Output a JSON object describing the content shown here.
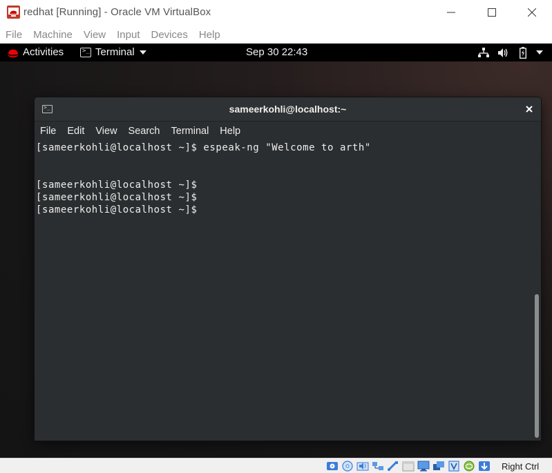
{
  "vbox": {
    "title": "redhat [Running] - Oracle VM VirtualBox",
    "menu": [
      "File",
      "Machine",
      "View",
      "Input",
      "Devices",
      "Help"
    ],
    "window_controls": {
      "minimize": "minimize-icon",
      "maximize": "maximize-icon",
      "close": "close-icon"
    },
    "status_icons": [
      "hard-disk-icon",
      "optical-disk-icon",
      "audio-icon",
      "network-icon",
      "usb-icon",
      "shared-folder-icon",
      "display-icon",
      "recording-icon",
      "cpu-icon",
      "mouse-integration-icon",
      "keyboard-icon"
    ],
    "host_key": "Right Ctrl"
  },
  "gnome": {
    "activities": "Activities",
    "app_menu": "Terminal",
    "clock": "Sep 30  22:43",
    "tray": [
      "network-icon",
      "volume-icon",
      "battery-icon"
    ]
  },
  "terminal": {
    "title": "sameerkohli@localhost:~",
    "menu": [
      "File",
      "Edit",
      "View",
      "Search",
      "Terminal",
      "Help"
    ],
    "lines": [
      "[sameerkohli@localhost ~]$ espeak-ng \"Welcome to arth\"",
      "",
      "",
      "[sameerkohli@localhost ~]$",
      "[sameerkohli@localhost ~]$",
      "[sameerkohli@localhost ~]$"
    ]
  },
  "colors": {
    "terminal_bg": "#2b2e31",
    "terminal_fg": "#eeeeec",
    "topbar_bg": "#000000",
    "redhat_red": "#ee0000"
  }
}
